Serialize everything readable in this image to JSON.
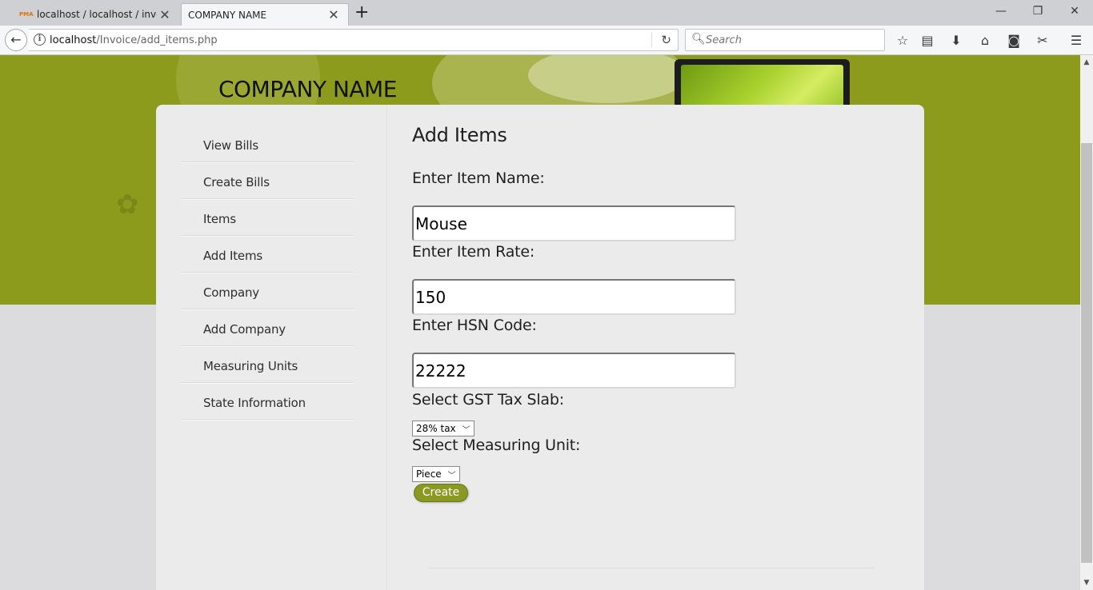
{
  "browser": {
    "tabs": [
      {
        "title": "localhost / localhost / invoic",
        "favicon": "PMA",
        "active": false
      },
      {
        "title": "COMPANY NAME",
        "active": true
      }
    ],
    "url_host": "localhost",
    "url_path": "/Invoice/add_items.php",
    "search_placeholder": "Search",
    "info_glyph": "i",
    "icons": [
      "back-arrow-icon",
      "info-icon",
      "reload-icon",
      "search-icon",
      "bookmark-star-icon",
      "reading-list-icon",
      "download-icon",
      "home-icon",
      "pocket-icon",
      "screenshot-icon",
      "menu-icon"
    ]
  },
  "header": {
    "company_name": "COMPANY NAME"
  },
  "sidebar": {
    "items": [
      {
        "label": "View Bills"
      },
      {
        "label": "Create Bills"
      },
      {
        "label": "Items"
      },
      {
        "label": "Add Items"
      },
      {
        "label": "Company"
      },
      {
        "label": "Add Company"
      },
      {
        "label": "Measuring Units"
      },
      {
        "label": "State Information"
      }
    ]
  },
  "form": {
    "title": "Add Items",
    "item_name_label": "Enter Item Name:",
    "item_name_value": "Mouse",
    "item_rate_label": "Enter Item Rate:",
    "item_rate_value": "150",
    "hsn_label": "Enter HSN Code:",
    "hsn_value": "22222",
    "gst_label": "Select GST Tax Slab:",
    "gst_selected": "28% tax",
    "unit_label": "Select Measuring Unit:",
    "unit_selected": "Piece",
    "submit_label": "Create"
  },
  "colors": {
    "header_band": "#8d9b1c",
    "panel": "#ebebeb",
    "button": "#8a991f"
  }
}
